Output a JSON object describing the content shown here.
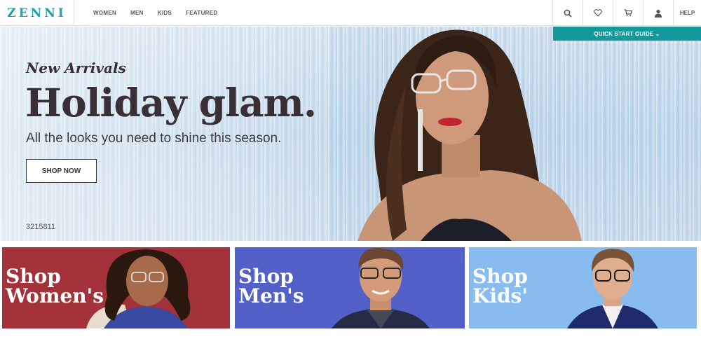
{
  "brand": {
    "logo": "ZENNI",
    "accent": "#13989c"
  },
  "nav": [
    {
      "label": "WOMEN"
    },
    {
      "label": "MEN"
    },
    {
      "label": "KIDS"
    },
    {
      "label": "FEATURED"
    }
  ],
  "header_icons": {
    "search": "search-icon",
    "wishlist": "heart-icon",
    "cart": "cart-icon",
    "account": "user-icon",
    "help_label": "HELP"
  },
  "quick_start": {
    "label": "QUICK START GUIDE ⌄"
  },
  "hero": {
    "eyebrow": "New Arrivals",
    "title": "Holiday glam.",
    "subtitle": "All the looks you need to shine this season.",
    "cta": "SHOP NOW",
    "code": "3215811"
  },
  "tiles": [
    {
      "line1": "Shop",
      "line2": "Women's",
      "color": "#a3323a"
    },
    {
      "line1": "Shop",
      "line2": "Men's",
      "color": "#5360c8"
    },
    {
      "line1": "Shop",
      "line2": "Kids'",
      "color": "#88bcef"
    }
  ]
}
